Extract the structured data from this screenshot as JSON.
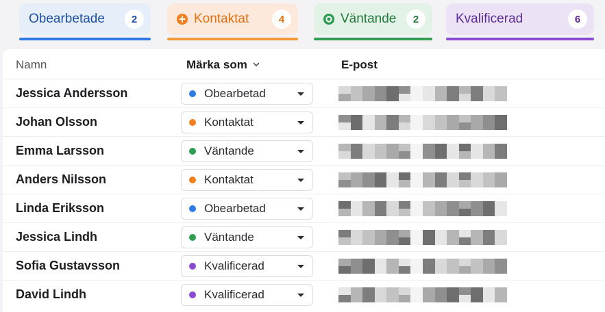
{
  "tabs": [
    {
      "label": "Obearbetade",
      "count": "2",
      "icon": "",
      "accent": "#2f7be6"
    },
    {
      "label": "Kontaktat",
      "count": "4",
      "icon": "plus-circle-icon",
      "accent": "#f07f1f"
    },
    {
      "label": "Väntande",
      "count": "2",
      "icon": "record-circle-icon",
      "accent": "#2f9d52"
    },
    {
      "label": "Kvalificerad",
      "count": "6",
      "icon": "",
      "accent": "#8b4bd1"
    }
  ],
  "table": {
    "headers": {
      "name": "Namn",
      "mark": "Märka som",
      "email": "E-post"
    },
    "rows": [
      {
        "name": "Jessica Andersson",
        "status": "Obearbetad",
        "status_color": "#2f7be6",
        "email": "pixelated"
      },
      {
        "name": "Johan Olsson",
        "status": "Kontaktat",
        "status_color": "#f07f1f",
        "email": "pixelated"
      },
      {
        "name": "Emma Larsson",
        "status": "Väntande",
        "status_color": "#2f9d52",
        "email": "pixelated"
      },
      {
        "name": "Anders Nilsson",
        "status": "Kontaktat",
        "status_color": "#f07f1f",
        "email": "pixelated"
      },
      {
        "name": "Linda Eriksson",
        "status": "Obearbetad",
        "status_color": "#2f7be6",
        "email": "pixelated"
      },
      {
        "name": "Jessica Lindh",
        "status": "Väntande",
        "status_color": "#2f9d52",
        "email": "pixelated"
      },
      {
        "name": "Sofia Gustavsson",
        "status": "Kvalificerad",
        "status_color": "#8b4bd1",
        "email": "pixelated"
      },
      {
        "name": "David Lindh",
        "status": "Kvalificerad",
        "status_color": "#8b4bd1",
        "email": "pixelated"
      }
    ]
  }
}
